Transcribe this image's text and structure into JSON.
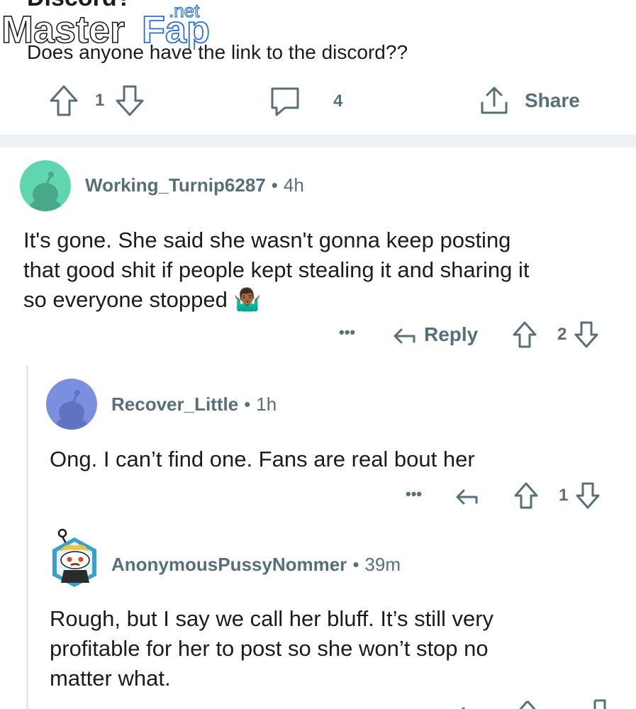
{
  "post": {
    "title_fragment": "Discord?",
    "body": "Does anyone have the link to the discord??",
    "upvotes": "1",
    "comments": "4",
    "share_label": "Share"
  },
  "watermark": {
    "brand_left": "Master",
    "brand_right": "Fap",
    "brand_suffix": ".net"
  },
  "comments": [
    {
      "username": "Working_Turnip6287",
      "separator": "•",
      "age": "4h",
      "text_line1": "It's gone. She said she wasn't gonna keep posting",
      "text_line2": "that good shit if people kept stealing it and sharing it",
      "text_line3": "so everyone stopped",
      "emoji": "🤷🏾‍♂️",
      "more": "•••",
      "reply_label": "Reply",
      "votes": "2",
      "avatar_color": "#5fd6b0"
    },
    {
      "username": "Recover_Little",
      "separator": "•",
      "age": "1h",
      "text": "Ong. I can’t find one. Fans are real bout her",
      "more": "•••",
      "votes": "1",
      "avatar_color": "#7b8fe0"
    },
    {
      "username": "AnonymousPussyNommer",
      "separator": "•",
      "age": "39m",
      "text_line1": "Rough, but I say we call her bluff. It’s still very",
      "text_line2": "profitable for her to post so she won’t stop no",
      "text_line3": "matter what.",
      "avatar_color": "#3aa1c9"
    }
  ],
  "colors": {
    "meta_gray": "#576f76",
    "divider": "#eef1f3",
    "watermark_blue": "#2a6fd6"
  }
}
